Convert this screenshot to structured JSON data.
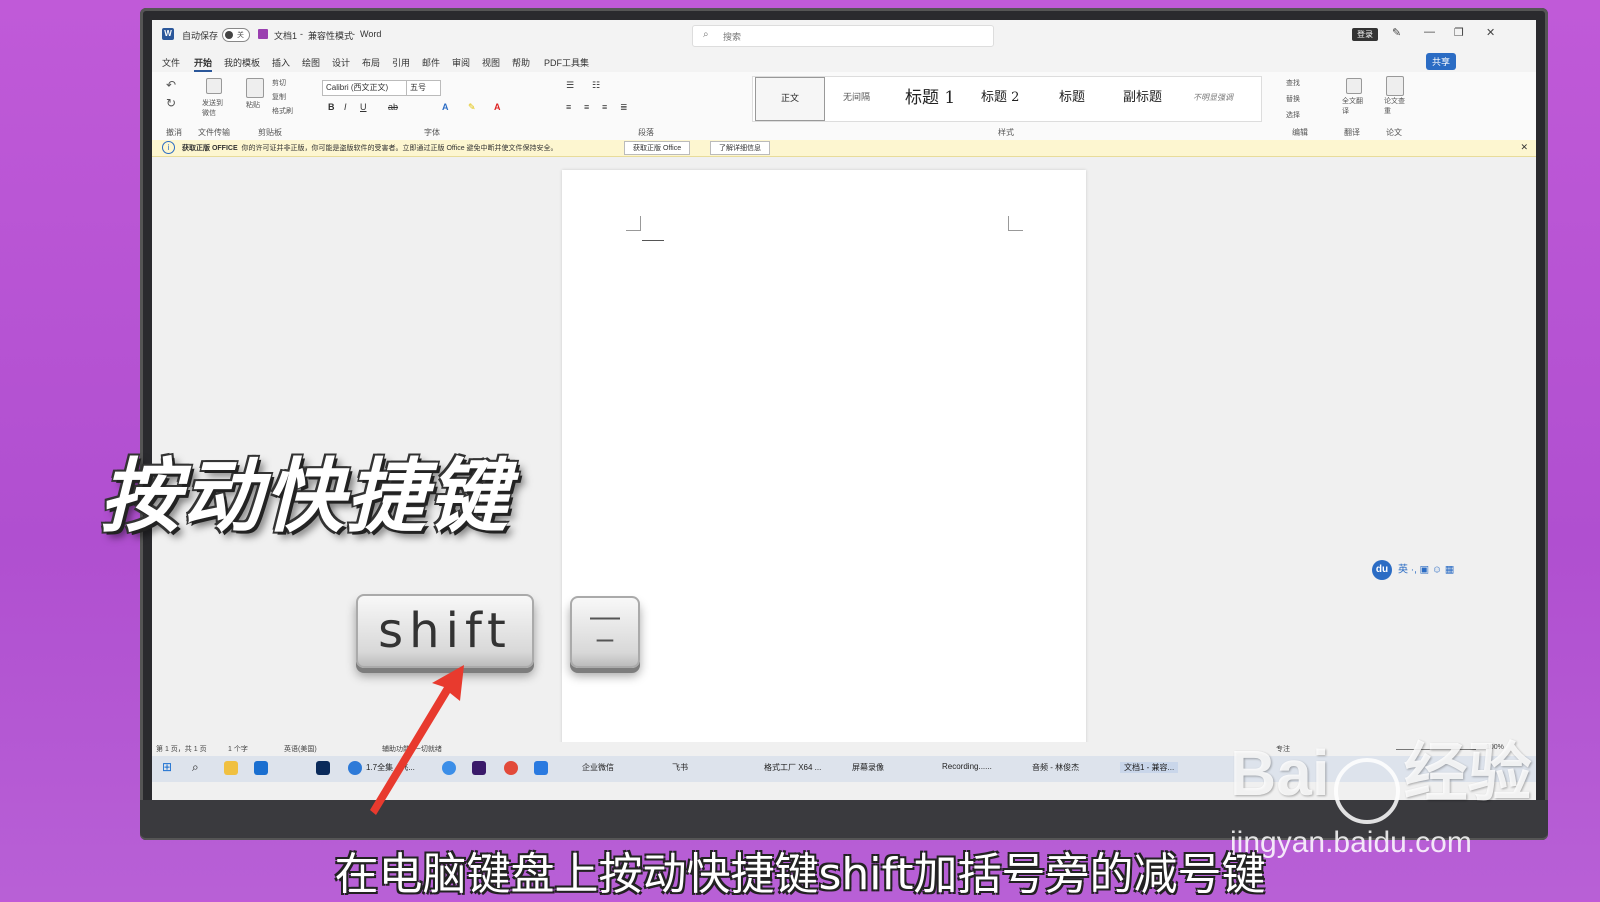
{
  "titlebar": {
    "autosave_label": "自动保存",
    "autosave_state": "关",
    "doc_title": "文档1",
    "mode": "兼容性模式",
    "app": "Word",
    "search_placeholder": "搜索",
    "login": "登录"
  },
  "menu": {
    "tabs": [
      "文件",
      "开始",
      "我的模板",
      "插入",
      "绘图",
      "设计",
      "布局",
      "引用",
      "邮件",
      "审阅",
      "视图",
      "帮助",
      "PDF工具集"
    ],
    "share": "共享"
  },
  "ribbon": {
    "undo_group": "撤消",
    "transfer": "发送到微信",
    "transfer_group": "文件传输",
    "paste": "粘贴",
    "cut": "剪切",
    "copy": "复制",
    "painter": "格式刷",
    "clipboard_group": "剪贴板",
    "font_name": "Calibri (西文正文)",
    "font_size": "五号",
    "font_group": "字体",
    "paragraph_group": "段落",
    "styles": [
      "正文",
      "无间隔",
      "标题 1",
      "标题 2",
      "标题",
      "副标题",
      "不明显强调"
    ],
    "styles_group": "样式",
    "find": "查找",
    "replace": "替换",
    "select": "选择",
    "edit_group": "编辑",
    "translate": "全文翻译",
    "translate_group": "翻译",
    "paper_check": "论文查重",
    "paper_group": "论文"
  },
  "notice": {
    "title": "获取正版 OFFICE",
    "text": "你的许可证并非正版，你可能是盗版软件的受害者。立即通过正版 Office 避免中断并使文件保持安全。",
    "btn1": "获取正版 Office",
    "btn2": "了解详细信息"
  },
  "statusbar": {
    "page": "第 1 页，共 1 页",
    "words": "1 个字",
    "lang": "英语(美国)",
    "accessibility": "辅助功能: 一切就绪",
    "focus": "专注",
    "zoom": "100%"
  },
  "taskbar": {
    "items": [
      "1.7全集 - 飞...",
      "企业微信",
      "飞书",
      "格式工厂 X64 ...",
      "屏幕录像",
      "Recording......",
      "音频 - 林俊杰",
      "文档1 - 兼容..."
    ]
  },
  "ime": {
    "logo": "du",
    "lang": "英"
  },
  "overlay": {
    "title": "按动快捷键",
    "key1": "shift",
    "key2_top": "—",
    "key2_bottom": "–",
    "caption": "在电脑键盘上按动快捷键shift加括号旁的减号键"
  },
  "watermark": {
    "brand": "Bai",
    "brand2": "经验",
    "url": "jingyan.baidu.com"
  }
}
